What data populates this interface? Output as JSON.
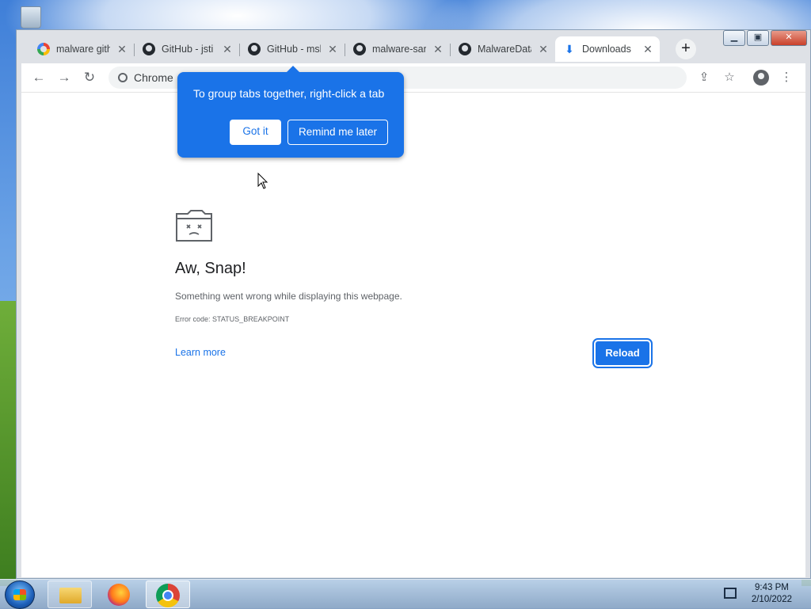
{
  "tabs": [
    {
      "title": "malware gith",
      "favicon": "google-icon"
    },
    {
      "title": "GitHub - jsti",
      "favicon": "github-icon"
    },
    {
      "title": "GitHub - msl",
      "favicon": "github-icon"
    },
    {
      "title": "malware-san",
      "favicon": "github-icon"
    },
    {
      "title": "MalwareData",
      "favicon": "github-icon"
    },
    {
      "title": "Downloads",
      "favicon": "download-icon",
      "active": true
    }
  ],
  "omnibox": {
    "text": "Chrome"
  },
  "bubble": {
    "message": "To group tabs together, right-click a tab",
    "got_it": "Got it",
    "remind_later": "Remind me later"
  },
  "sad_tab": {
    "title": "Aw, Snap!",
    "message": "Something went wrong while displaying this webpage.",
    "error_code": "Error code: STATUS_BREAKPOINT",
    "learn_more": "Learn more",
    "reload": "Reload"
  },
  "taskbar": {
    "time": "9:43 PM",
    "date": "2/10/2022"
  },
  "colors": {
    "accent": "#1a73e8",
    "tabstrip": "#dee1e6"
  }
}
